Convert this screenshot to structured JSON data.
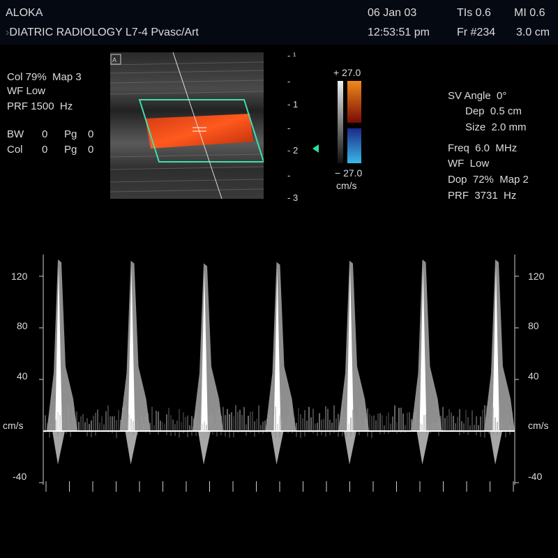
{
  "header": {
    "brand": "ALOKA",
    "institution": "DIATRIC RADIOLOGY",
    "probe": "L7-4",
    "preset": "Pvasc/Art",
    "date": "06 Jan 03",
    "time": "12:53:51 pm",
    "tis": "TIs 0.6",
    "mi": "MI 0.6",
    "frame": "Fr #234",
    "depth": "3.0 cm"
  },
  "color_settings": {
    "col": "Col 79%",
    "map": "Map 3",
    "wf": "WF Low",
    "prf": "PRF 1500  Hz",
    "bw": "BW",
    "bw_val": "0",
    "pg_label": "Pg",
    "pg_val": "0",
    "col_label": "Col",
    "col_val": "0",
    "pg2_val": "0"
  },
  "depth_scale": {
    "ticks": [
      "1",
      "2",
      "3"
    ]
  },
  "color_bar": {
    "top": "+ 27.0",
    "bottom": "− 27.0",
    "unit": "cm/s",
    "colors": {
      "positive_top": "#f08a1a",
      "positive_bottom": "#7a0a05",
      "negative_top": "#1a2a8a",
      "negative_bottom": "#3ab8e6"
    }
  },
  "doppler_settings": {
    "sv_angle": "SV Angle  0°",
    "dep": "Dep  0.5 cm",
    "size": "Size  2.0 mm",
    "freq": "Freq  6.0  MHz",
    "wf": "WF  Low",
    "dop": "Dop  72%  Map 2",
    "prf": "PRF  3731  Hz"
  },
  "spectral_scale": {
    "unit": "cm/s",
    "ticks": [
      "120",
      "80",
      "40",
      "-40"
    ]
  },
  "chart_data": {
    "type": "line",
    "ylabel": "cm/s",
    "ylim": [
      -45,
      140
    ],
    "peak_systolic_values": [
      133,
      132,
      130,
      131,
      132,
      133,
      133
    ],
    "baseline": 0
  },
  "colors": {
    "roi_box": "#3ee0b0",
    "marker": "#2ee0a0",
    "trace": "#ffffff"
  }
}
